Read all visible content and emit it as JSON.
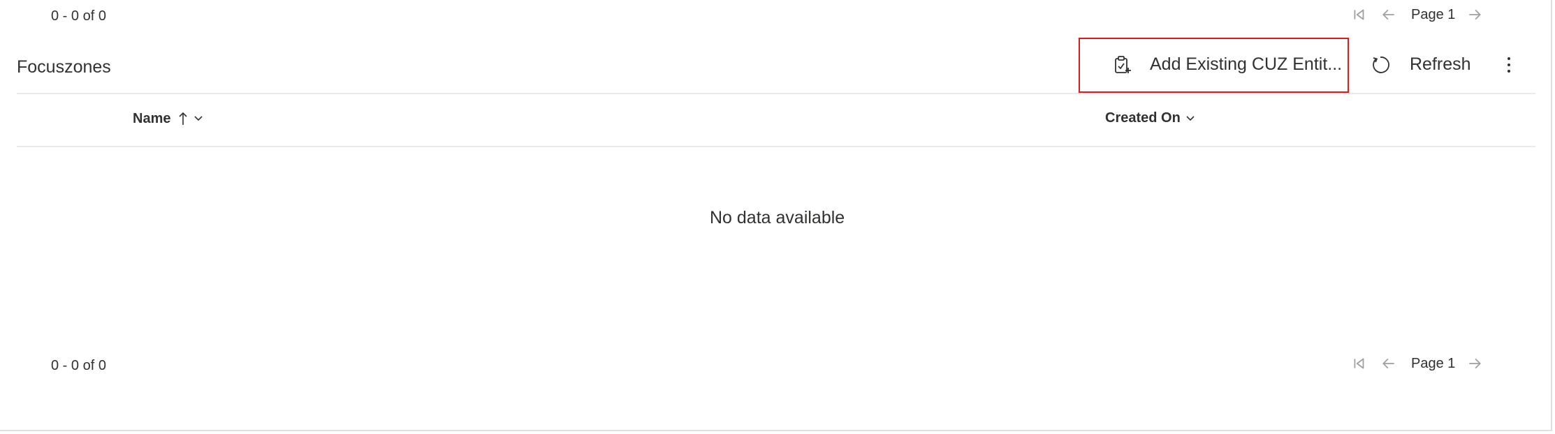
{
  "top_pager": {
    "range_text": "0 - 0 of 0",
    "page_label": "Page 1"
  },
  "subgrid": {
    "title": "Focuszones",
    "commands": {
      "add_existing_label": "Add Existing CUZ Entit...",
      "refresh_label": "Refresh"
    },
    "columns": [
      {
        "label": "Name",
        "sort": "ascending"
      },
      {
        "label": "Created On",
        "sort": "none"
      }
    ],
    "empty_message": "No data available"
  },
  "bottom_pager": {
    "range_text": "0 - 0 of 0",
    "page_label": "Page 1"
  },
  "colors": {
    "highlight_border": "#e01919",
    "disabled_icon": "#a19f9d",
    "text": "#323130"
  }
}
